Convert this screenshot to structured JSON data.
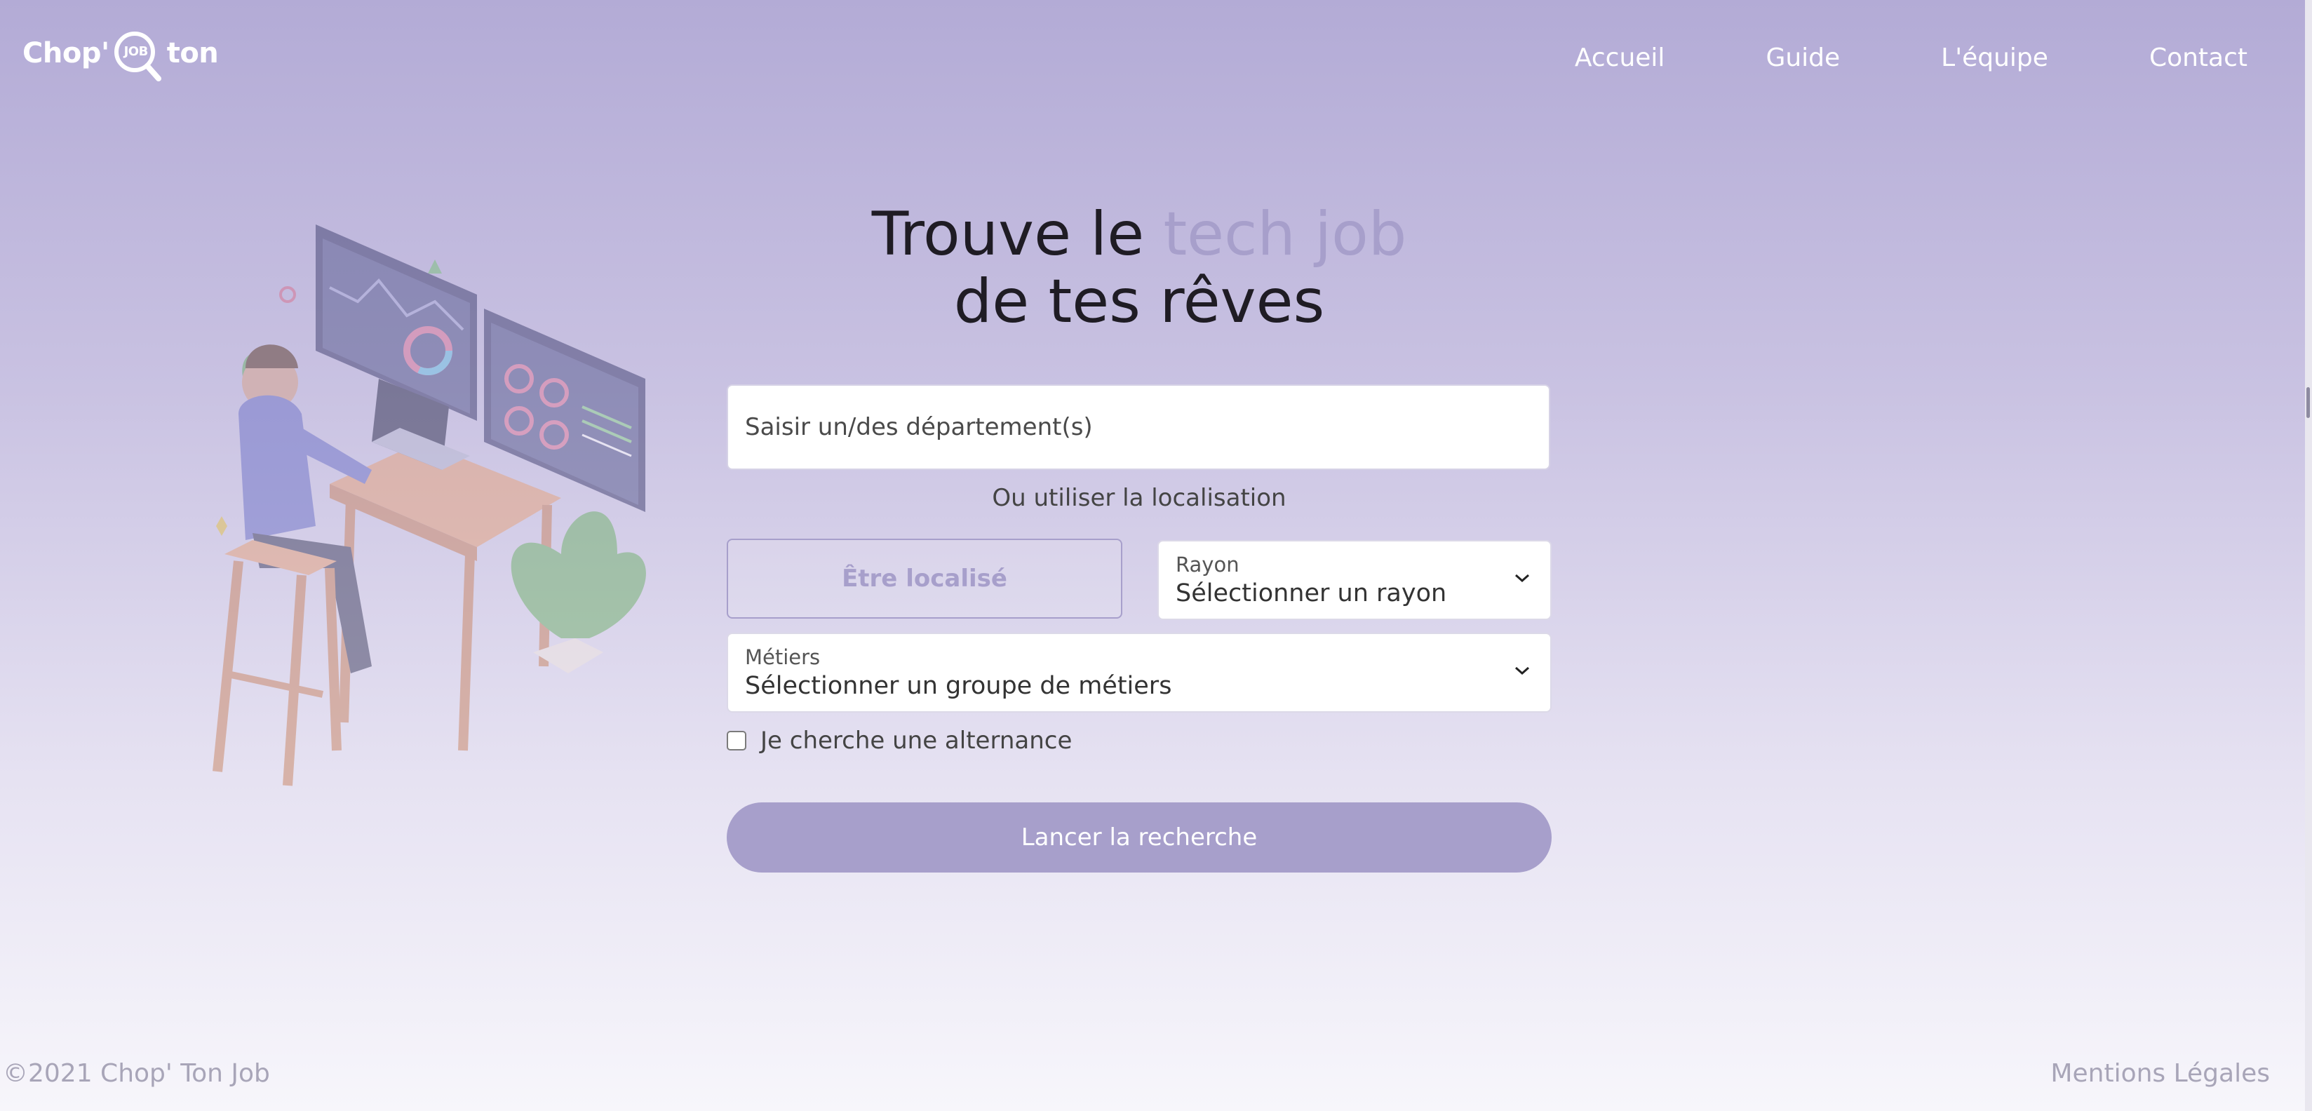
{
  "brand": {
    "logo_left": "Chop'",
    "logo_mag": "JOB",
    "logo_right": "ton"
  },
  "nav": {
    "items": [
      {
        "label": "Accueil"
      },
      {
        "label": "Guide"
      },
      {
        "label": "L'équipe"
      },
      {
        "label": "Contact"
      }
    ]
  },
  "hero": {
    "title_prefix": "Trouve le ",
    "title_accent": "tech job",
    "title_line2": "de tes rêves"
  },
  "search_form": {
    "department_placeholder": "Saisir un/des département(s)",
    "or_text": "Ou utiliser la localisation",
    "locate_label": "Être localisé",
    "rayon": {
      "label": "Rayon",
      "value": "Sélectionner un rayon"
    },
    "metiers": {
      "label": "Métiers",
      "value": "Sélectionner un groupe de métiers"
    },
    "alternance_label": "Je cherche une alternance",
    "alternance_checked": false,
    "submit_label": "Lancer la recherche"
  },
  "footer": {
    "copyright": "©2021 Chop' Ton Job",
    "legal": "Mentions Légales"
  },
  "colors": {
    "accent": "#a79fcb",
    "gradient_top": "#b3abd6",
    "gradient_bottom": "#f7f6fb",
    "title_text": "#1f1c24"
  },
  "icons": {
    "logo_magnifier": "magnifier-icon",
    "select_chevron": "chevron-down-icon",
    "illustration": "developer-at-desk-illustration"
  }
}
